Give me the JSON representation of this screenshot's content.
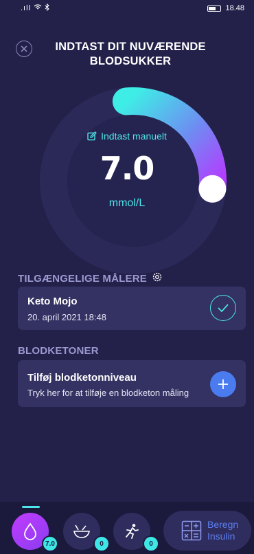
{
  "status_bar": {
    "signal": ".ıll",
    "time": "18.48"
  },
  "header": {
    "title": "INDTAST DIT NUVÆRENDE BLODSUKKER"
  },
  "gauge": {
    "level": 0.28
  },
  "reading": {
    "manual_label": "Indtast manuelt",
    "value": "7.0",
    "unit": "mmol/L"
  },
  "meters": {
    "heading": "TILGÆNGELIGE MÅLERE",
    "items": [
      {
        "name": "Keto Mojo",
        "timestamp": "20. april 2021 18:48"
      }
    ]
  },
  "ketones": {
    "heading": "BLODKETONER",
    "card_title": "Tilføj blodketonniveau",
    "card_subtitle": "Tryk her for at tilføje en blodketon måling"
  },
  "bottom_nav": {
    "glucose_count": "7.0",
    "food_count": "0",
    "activity_count": "0",
    "insulin_label_line1": "Beregn",
    "insulin_label_line2": "Insulin"
  },
  "colors": {
    "background": "#23214a",
    "accent_cyan": "#4ee6e9",
    "accent_purple": "#a53cff",
    "card": "#343263",
    "plus_button": "#4a7cf0"
  }
}
